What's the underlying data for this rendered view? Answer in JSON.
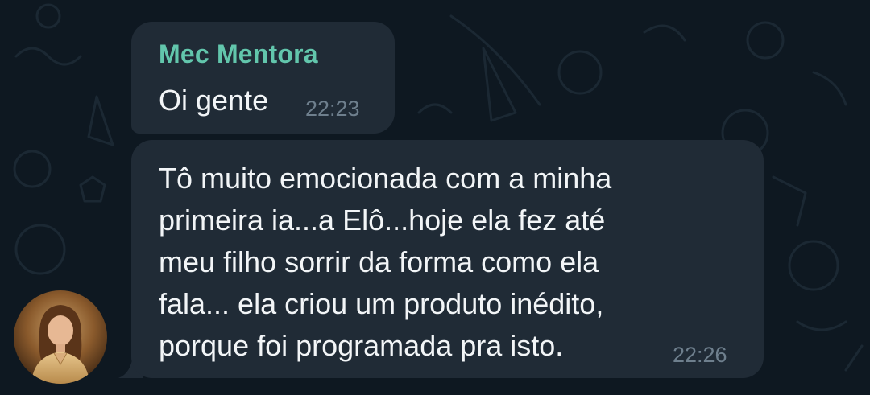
{
  "chat": {
    "sender_name": "Mec Mentora",
    "colors": {
      "background": "#0e1821",
      "bubble": "#202b36",
      "sender_name": "#62c6ac",
      "message_text": "#f2f5f7",
      "timestamp": "#6e7f8d"
    },
    "messages": [
      {
        "text": "Oi gente",
        "time": "22:23"
      },
      {
        "lines": [
          "Tô muito emocionada com a minha",
          "primeira ia...a Elô...hoje ela fez até",
          "meu filho sorrir da forma como ela",
          "fala... ela criou um produto inédito,",
          "porque foi programada pra isto."
        ],
        "time": "22:26"
      }
    ],
    "avatar_icon": "user-photo-avatar"
  }
}
